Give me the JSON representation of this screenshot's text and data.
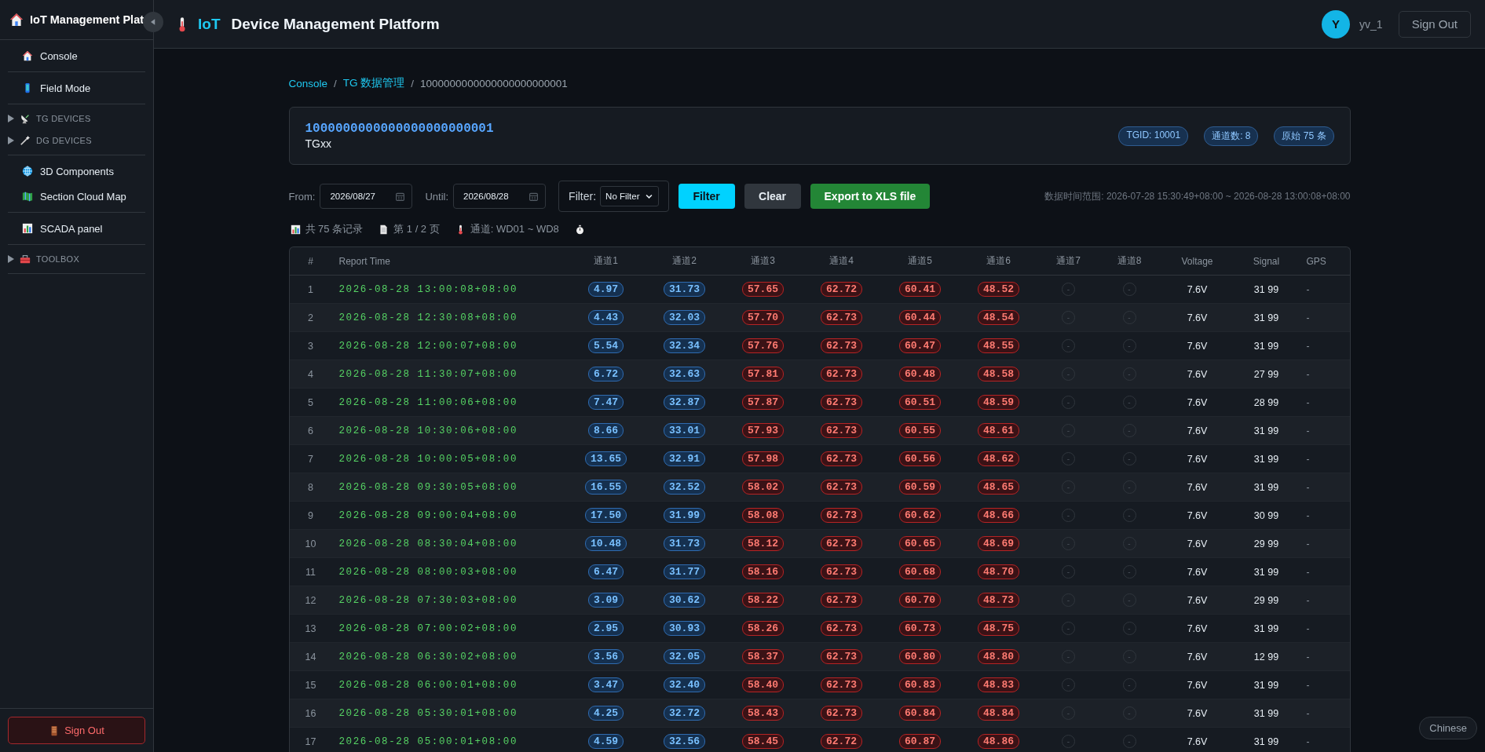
{
  "sidebar": {
    "title": "IoT Management Plat",
    "groups": [
      [
        {
          "label": "Console",
          "kind": "link"
        }
      ],
      [
        {
          "label": "Field Mode",
          "kind": "link"
        }
      ],
      [
        {
          "label": "TG DEVICES",
          "kind": "tree",
          "expanded": false
        },
        {
          "label": "DG DEVICES",
          "kind": "tree",
          "expanded": false
        }
      ],
      [
        {
          "label": "3D Components",
          "kind": "link"
        },
        {
          "label": "Section Cloud Map",
          "kind": "link"
        }
      ],
      [
        {
          "label": "SCADA panel",
          "kind": "link"
        }
      ],
      [
        {
          "label": "TOOLBOX",
          "kind": "tree",
          "expanded": false
        }
      ]
    ],
    "sign_out": "Sign Out"
  },
  "header": {
    "brand": "IoT",
    "title": "Device Management Platform",
    "avatar": "Y",
    "username": "yv_1",
    "sign_out": "Sign Out"
  },
  "breadcrumb": [
    {
      "label": "Console",
      "kind": "link"
    },
    {
      "label": "/",
      "kind": "separator"
    },
    {
      "label": "TG 数据管理",
      "kind": "link"
    },
    {
      "label": "/",
      "kind": "separator"
    },
    {
      "label": "1000000000000000000000001",
      "kind": "current"
    }
  ],
  "device": {
    "id": "1000000000000000000000001",
    "name": "TGxx",
    "badges": [
      "TGID: 10001",
      "通道数: 8",
      "原始 75 条"
    ]
  },
  "toolbar": {
    "from_label": "From:",
    "from": "2026/08/27",
    "until_label": "Until:",
    "until": "2026/08/28",
    "filter_label": "Filter:",
    "filter_value": "No Filter",
    "buttons": [
      {
        "label": "Filter",
        "kind": "primary"
      },
      {
        "label": "Clear",
        "kind": "secondary"
      },
      {
        "label": "Export to XLS file",
        "kind": "success"
      }
    ],
    "range": "数据时间范围: 2026-07-28 15:30:49+08:00 ~ 2026-08-28 13:00:08+08:00"
  },
  "stats": [
    "共 75 条记录",
    "第 1 / 2 页",
    "通道: WD01 ~ WD8"
  ],
  "table": {
    "columns": [
      {
        "label": "#"
      },
      {
        "label": "Report Time"
      },
      {
        "label": "通道1",
        "kind": "low"
      },
      {
        "label": "通道2",
        "kind": "low"
      },
      {
        "label": "通道3",
        "kind": "high"
      },
      {
        "label": "通道4",
        "kind": "high"
      },
      {
        "label": "通道5",
        "kind": "high"
      },
      {
        "label": "通道6",
        "kind": "high"
      },
      {
        "label": "通道7",
        "kind": "empty"
      },
      {
        "label": "通道8",
        "kind": "empty"
      },
      {
        "label": "Voltage"
      },
      {
        "label": "Signal"
      },
      {
        "label": "GPS"
      }
    ],
    "rows": [
      {
        "no": "1",
        "time": "2026-08-28 13:00:08+08:00",
        "channels": [
          "4.97",
          "31.73",
          "57.65",
          "62.72",
          "60.41",
          "48.52",
          "-",
          "-"
        ],
        "voltage": "7.6V",
        "signal": "31 99",
        "gps": "-"
      },
      {
        "no": "2",
        "time": "2026-08-28 12:30:08+08:00",
        "channels": [
          "4.43",
          "32.03",
          "57.70",
          "62.73",
          "60.44",
          "48.54",
          "-",
          "-"
        ],
        "voltage": "7.6V",
        "signal": "31 99",
        "gps": "-"
      },
      {
        "no": "3",
        "time": "2026-08-28 12:00:07+08:00",
        "channels": [
          "5.54",
          "32.34",
          "57.76",
          "62.73",
          "60.47",
          "48.55",
          "-",
          "-"
        ],
        "voltage": "7.6V",
        "signal": "31 99",
        "gps": "-"
      },
      {
        "no": "4",
        "time": "2026-08-28 11:30:07+08:00",
        "channels": [
          "6.72",
          "32.63",
          "57.81",
          "62.73",
          "60.48",
          "48.58",
          "-",
          "-"
        ],
        "voltage": "7.6V",
        "signal": "27 99",
        "gps": "-"
      },
      {
        "no": "5",
        "time": "2026-08-28 11:00:06+08:00",
        "channels": [
          "7.47",
          "32.87",
          "57.87",
          "62.73",
          "60.51",
          "48.59",
          "-",
          "-"
        ],
        "voltage": "7.6V",
        "signal": "28 99",
        "gps": "-"
      },
      {
        "no": "6",
        "time": "2026-08-28 10:30:06+08:00",
        "channels": [
          "8.66",
          "33.01",
          "57.93",
          "62.73",
          "60.55",
          "48.61",
          "-",
          "-"
        ],
        "voltage": "7.6V",
        "signal": "31 99",
        "gps": "-"
      },
      {
        "no": "7",
        "time": "2026-08-28 10:00:05+08:00",
        "channels": [
          "13.65",
          "32.91",
          "57.98",
          "62.73",
          "60.56",
          "48.62",
          "-",
          "-"
        ],
        "voltage": "7.6V",
        "signal": "31 99",
        "gps": "-"
      },
      {
        "no": "8",
        "time": "2026-08-28 09:30:05+08:00",
        "channels": [
          "16.55",
          "32.52",
          "58.02",
          "62.73",
          "60.59",
          "48.65",
          "-",
          "-"
        ],
        "voltage": "7.6V",
        "signal": "31 99",
        "gps": "-"
      },
      {
        "no": "9",
        "time": "2026-08-28 09:00:04+08:00",
        "channels": [
          "17.50",
          "31.99",
          "58.08",
          "62.73",
          "60.62",
          "48.66",
          "-",
          "-"
        ],
        "voltage": "7.6V",
        "signal": "30 99",
        "gps": "-"
      },
      {
        "no": "10",
        "time": "2026-08-28 08:30:04+08:00",
        "channels": [
          "10.48",
          "31.73",
          "58.12",
          "62.73",
          "60.65",
          "48.69",
          "-",
          "-"
        ],
        "voltage": "7.6V",
        "signal": "29 99",
        "gps": "-"
      },
      {
        "no": "11",
        "time": "2026-08-28 08:00:03+08:00",
        "channels": [
          "6.47",
          "31.77",
          "58.16",
          "62.73",
          "60.68",
          "48.70",
          "-",
          "-"
        ],
        "voltage": "7.6V",
        "signal": "31 99",
        "gps": "-"
      },
      {
        "no": "12",
        "time": "2026-08-28 07:30:03+08:00",
        "channels": [
          "3.09",
          "30.62",
          "58.22",
          "62.73",
          "60.70",
          "48.73",
          "-",
          "-"
        ],
        "voltage": "7.6V",
        "signal": "29 99",
        "gps": "-"
      },
      {
        "no": "13",
        "time": "2026-08-28 07:00:02+08:00",
        "channels": [
          "2.95",
          "30.93",
          "58.26",
          "62.73",
          "60.73",
          "48.75",
          "-",
          "-"
        ],
        "voltage": "7.6V",
        "signal": "31 99",
        "gps": "-"
      },
      {
        "no": "14",
        "time": "2026-08-28 06:30:02+08:00",
        "channels": [
          "3.56",
          "32.05",
          "58.37",
          "62.73",
          "60.80",
          "48.80",
          "-",
          "-"
        ],
        "voltage": "7.6V",
        "signal": "12 99",
        "gps": "-"
      },
      {
        "no": "15",
        "time": "2026-08-28 06:00:01+08:00",
        "channels": [
          "3.47",
          "32.40",
          "58.40",
          "62.73",
          "60.83",
          "48.83",
          "-",
          "-"
        ],
        "voltage": "7.6V",
        "signal": "31 99",
        "gps": "-"
      },
      {
        "no": "16",
        "time": "2026-08-28 05:30:01+08:00",
        "channels": [
          "4.25",
          "32.72",
          "58.43",
          "62.73",
          "60.84",
          "48.84",
          "-",
          "-"
        ],
        "voltage": "7.6V",
        "signal": "31 99",
        "gps": "-"
      },
      {
        "no": "17",
        "time": "2026-08-28 05:00:01+08:00",
        "channels": [
          "4.59",
          "32.56",
          "58.45",
          "62.72",
          "60.87",
          "48.86",
          "-",
          "-"
        ],
        "voltage": "7.6V",
        "signal": "31 99",
        "gps": "-"
      }
    ]
  },
  "language_button": "Chinese"
}
